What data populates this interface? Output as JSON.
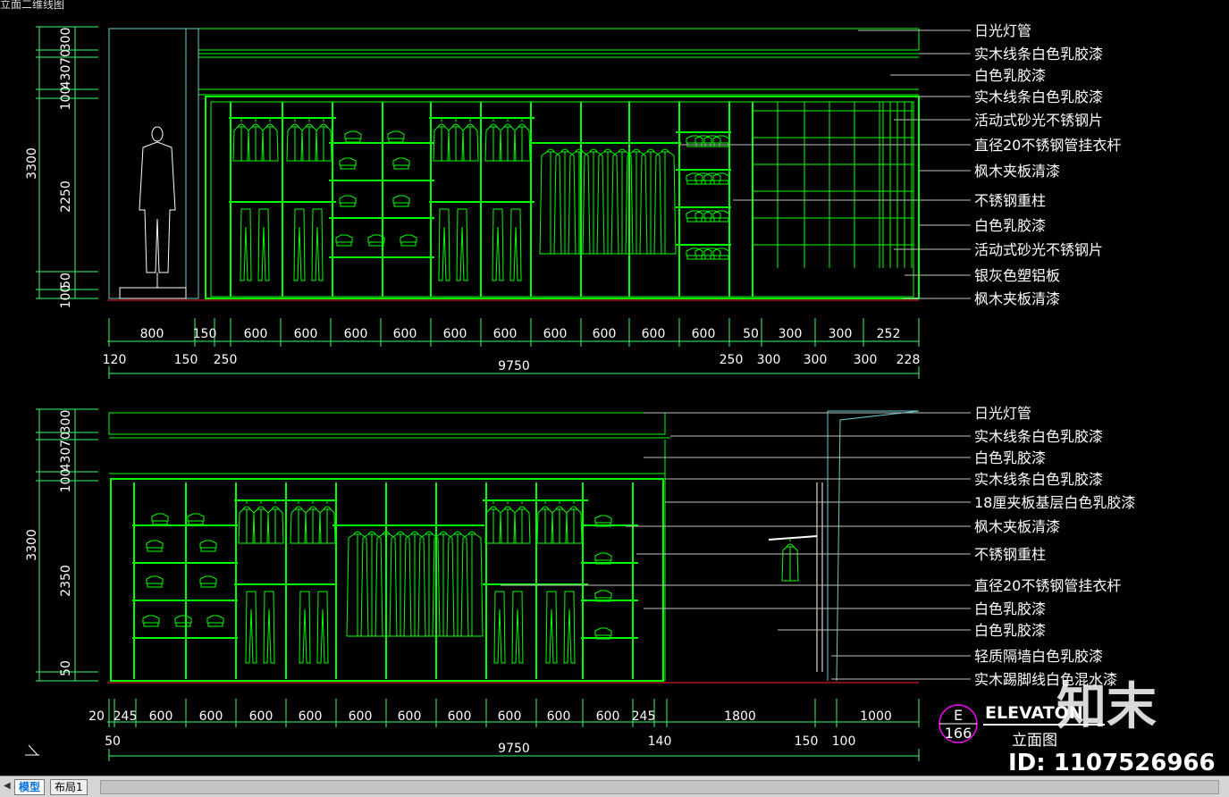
{
  "window_title_fragment": "立面二维线图",
  "top_elevation": {
    "left_dims": [
      "300",
      "70",
      "430",
      "100",
      "2250",
      "50",
      "100"
    ],
    "total_height": "3300",
    "bottom_dims_row1": [
      "800",
      "150",
      "600",
      "600",
      "600",
      "600",
      "600",
      "600",
      "600",
      "600",
      "600",
      "600",
      "50",
      "300",
      "300",
      "252"
    ],
    "bottom_dims_row2": [
      "120",
      "150",
      "250",
      "250",
      "300",
      "300",
      "300",
      "228"
    ],
    "total_width": "9750",
    "callouts": [
      "日光灯管",
      "实木线条白色乳胶漆",
      "白色乳胶漆",
      "实木线条白色乳胶漆",
      "活动式砂光不锈钢片",
      "直径20不锈钢管挂衣杆",
      "枫木夹板清漆",
      "不锈钢重柱",
      "白色乳胶漆",
      "活动式砂光不锈钢片",
      "银灰色塑铝板",
      "枫木夹板清漆"
    ]
  },
  "bottom_elevation": {
    "left_dims": [
      "300",
      "70",
      "430",
      "100",
      "2350",
      "50"
    ],
    "total_height": "3300",
    "bottom_dims_row1": [
      "20",
      "245",
      "600",
      "600",
      "600",
      "600",
      "600",
      "600",
      "600",
      "600",
      "600",
      "600",
      "245",
      "1800",
      "1000"
    ],
    "bottom_dims_row2": [
      "50",
      "140",
      "150",
      "100"
    ],
    "total_width": "9750",
    "callouts": [
      "日光灯管",
      "实木线条白色乳胶漆",
      "白色乳胶漆",
      "实木线条白色乳胶漆",
      "18厘夹板基层白色乳胶漆",
      "枫木夹板清漆",
      "不锈钢重柱",
      "直径20不锈钢管挂衣杆",
      "白色乳胶漆",
      "白色乳胶漆",
      "轻质隔墙白色乳胶漆",
      "实木踢脚线白色混水漆"
    ]
  },
  "title_block": {
    "letter": "E",
    "number": "166",
    "title_en": "ELEVATON",
    "title_cn": "立面图"
  },
  "watermark": {
    "logo_text": "知末",
    "id_text": "ID: 1107526966"
  },
  "tabs": {
    "model": "模型",
    "layout1": "布局1"
  },
  "colors": {
    "line_green": "#00ff00",
    "dim_green": "#33ff66",
    "text_white": "#ffffff",
    "leader": "#bfbfbf",
    "floor_red": "#ff2020",
    "magenta": "#ff00ff",
    "cyan_frame": "#66cccc"
  }
}
